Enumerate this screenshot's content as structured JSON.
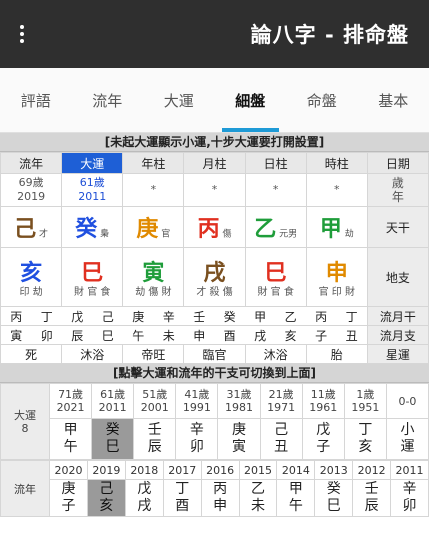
{
  "app": {
    "title": "論八字 - 排命盤"
  },
  "tabs": [
    "基本",
    "命盤",
    "細盤",
    "大運",
    "流年",
    "評語"
  ],
  "active_tab": "細盤",
  "section1": "[未起大運顯示小運,十步大運要打開設置]",
  "header": [
    "日期",
    "時柱",
    "日柱",
    "月柱",
    "年柱",
    "大運",
    "流年"
  ],
  "age_label": [
    "歲",
    "年"
  ],
  "ages": [
    "*",
    "*",
    "*",
    "*",
    [
      "61歲",
      "2011"
    ],
    [
      "69歲",
      "2019"
    ]
  ],
  "tiangan_label": "天干",
  "tiangan": [
    {
      "g": "甲",
      "c": "g",
      "s": "劫"
    },
    {
      "g": "乙",
      "c": "g",
      "s": "元男"
    },
    {
      "g": "丙",
      "c": "r",
      "s": "傷"
    },
    {
      "g": "庚",
      "c": "o",
      "s": "官"
    },
    {
      "g": "癸",
      "c": "b",
      "s": "梟"
    },
    {
      "g": "己",
      "c": "br",
      "s": "才"
    }
  ],
  "dizhi_label": "地支",
  "dizhi": [
    {
      "g": "申",
      "c": "o",
      "hid": "官 印 財"
    },
    {
      "g": "巳",
      "c": "r",
      "hid": "財 官 食"
    },
    {
      "g": "戌",
      "c": "br",
      "hid": "才 殺 傷"
    },
    {
      "g": "寅",
      "c": "g",
      "hid": "劫 傷 財"
    },
    {
      "g": "巳",
      "c": "r",
      "hid": "財 官 食"
    },
    {
      "g": "亥",
      "c": "b",
      "hid": "印 劫"
    }
  ],
  "liuyue_gan_label": "流月干",
  "liuyue_gan": [
    "丁",
    "丙",
    "乙",
    "甲",
    "癸",
    "壬",
    "辛",
    "庚",
    "己",
    "戊",
    "丁",
    "丙"
  ],
  "liuyue_zhi_label": "流月支",
  "liuyue_zhi": [
    "丑",
    "子",
    "亥",
    "戌",
    "酉",
    "申",
    "未",
    "午",
    "巳",
    "辰",
    "卯",
    "寅"
  ],
  "xingyun_label": "星運",
  "xingyun": [
    "胎",
    "沐浴",
    "臨官",
    "帝旺",
    "沐浴",
    "死"
  ],
  "section2": "[點擊大運和流年的干支可切換到上面]",
  "dayun_label": [
    "大運",
    "8"
  ],
  "dayun_ages": [
    [
      "0-0",
      ""
    ],
    [
      "1歲",
      "1951"
    ],
    [
      "11歲",
      "1961"
    ],
    [
      "21歲",
      "1971"
    ],
    [
      "31歲",
      "1981"
    ],
    [
      "41歲",
      "1991"
    ],
    [
      "51歲",
      "2001"
    ],
    [
      "61歲",
      "2011"
    ],
    [
      "71歲",
      "2021"
    ]
  ],
  "dayun_gz": [
    [
      "小",
      "運"
    ],
    [
      "丁",
      "亥"
    ],
    [
      "戊",
      "子"
    ],
    [
      "己",
      "丑"
    ],
    [
      "庚",
      "寅"
    ],
    [
      "辛",
      "卯"
    ],
    [
      "壬",
      "辰"
    ],
    [
      "癸",
      "巳"
    ],
    [
      "甲",
      "午"
    ]
  ],
  "dayun_selected": 7,
  "liunian_years": [
    "2011",
    "2012",
    "2013",
    "2014",
    "2015",
    "2016",
    "2017",
    "2018",
    "2019",
    "2020"
  ],
  "liunian_label": "流年",
  "liunian_gz": [
    [
      "辛",
      "卯"
    ],
    [
      "壬",
      "辰"
    ],
    [
      "癸",
      "巳"
    ],
    [
      "甲",
      "午"
    ],
    [
      "乙",
      "未"
    ],
    [
      "丙",
      "申"
    ],
    [
      "丁",
      "酉"
    ],
    [
      "戊",
      "戌"
    ],
    [
      "己",
      "亥"
    ],
    [
      "庚",
      "子"
    ]
  ],
  "liunian_selected": 8
}
